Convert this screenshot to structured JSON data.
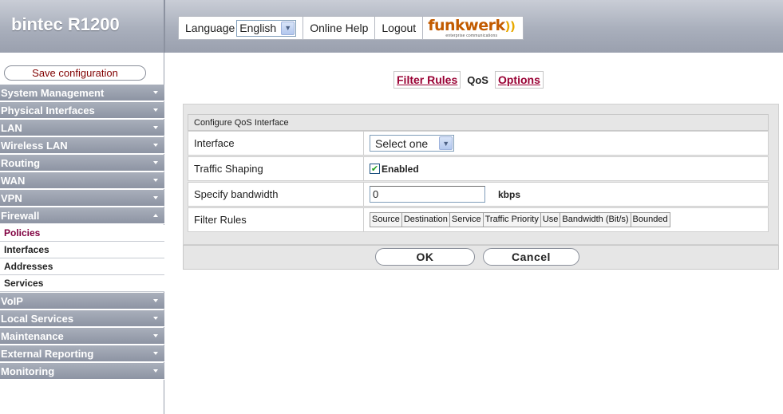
{
  "header": {
    "brand": "bintec R1200",
    "language_label": "Language",
    "language_value": "English",
    "online_help": "Online Help",
    "logout": "Logout",
    "logo_name": "funkwerk",
    "logo_tagline": "enterprise communications"
  },
  "sidebar": {
    "save_label": "Save configuration",
    "items": [
      {
        "label": "System Management",
        "state": "collapsed"
      },
      {
        "label": "Physical Interfaces",
        "state": "collapsed"
      },
      {
        "label": "LAN",
        "state": "collapsed"
      },
      {
        "label": "Wireless LAN",
        "state": "collapsed"
      },
      {
        "label": "Routing",
        "state": "collapsed"
      },
      {
        "label": "WAN",
        "state": "collapsed"
      },
      {
        "label": "VPN",
        "state": "collapsed"
      },
      {
        "label": "Firewall",
        "state": "expanded"
      },
      {
        "label": "VoIP",
        "state": "collapsed"
      },
      {
        "label": "Local Services",
        "state": "collapsed"
      },
      {
        "label": "Maintenance",
        "state": "collapsed"
      },
      {
        "label": "External Reporting",
        "state": "collapsed"
      },
      {
        "label": "Monitoring",
        "state": "collapsed"
      }
    ],
    "firewall_sub": [
      {
        "label": "Policies",
        "active": true
      },
      {
        "label": "Interfaces",
        "active": false
      },
      {
        "label": "Addresses",
        "active": false
      },
      {
        "label": "Services",
        "active": false
      }
    ]
  },
  "tabs": [
    "Filter Rules",
    "QoS",
    "Options"
  ],
  "active_tab": "QoS",
  "form": {
    "title": "Configure QoS Interface",
    "interface_label": "Interface",
    "interface_value": "Select one",
    "traffic_label": "Traffic Shaping",
    "traffic_checked": true,
    "traffic_value": "Enabled",
    "bandwidth_label": "Specify bandwidth",
    "bandwidth_value": "0",
    "bandwidth_unit": "kbps",
    "filter_rules_label": "Filter Rules",
    "filter_columns": [
      "Source",
      "Destination",
      "Service",
      "Traffic Priority",
      "Use",
      "Bandwidth (Bit/s)",
      "Bounded"
    ]
  },
  "buttons": {
    "ok": "OK",
    "cancel": "Cancel"
  },
  "colors": {
    "link": "#990033",
    "nav_bg": "#8d94a3",
    "active_sub": "#800040",
    "save": "#800000",
    "logo": "#c25b00"
  }
}
